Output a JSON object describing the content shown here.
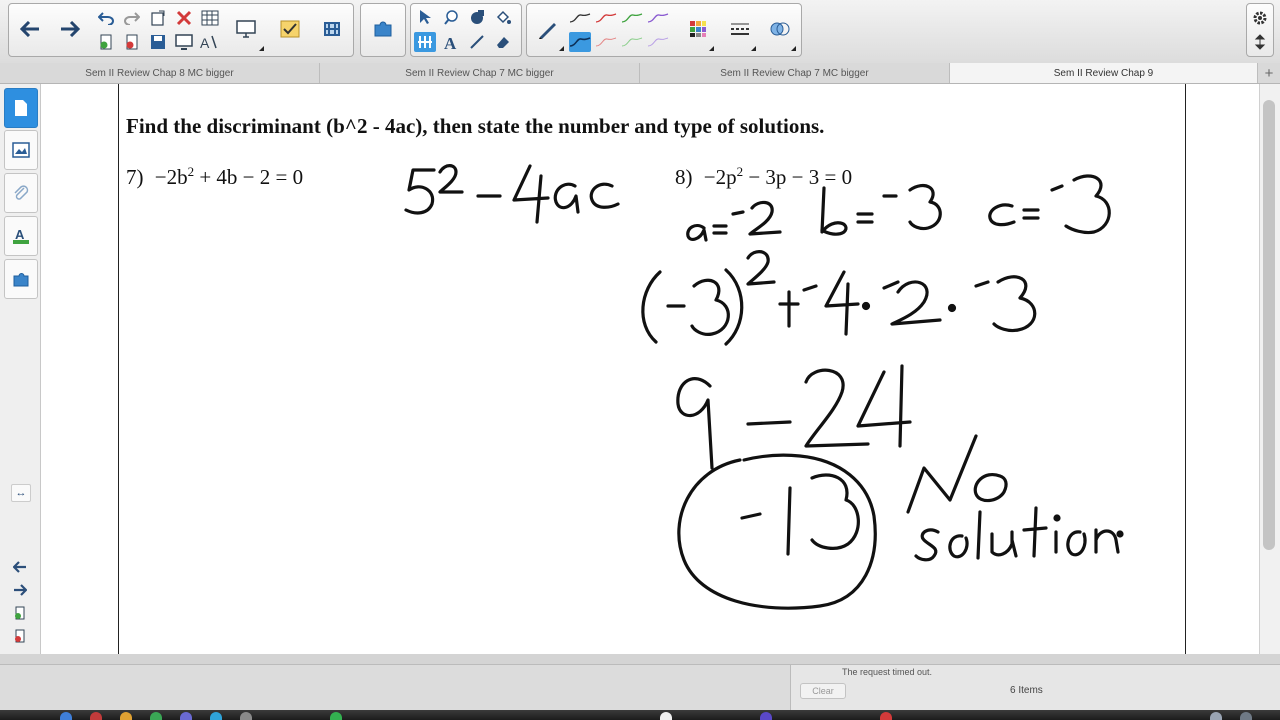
{
  "tabs": [
    {
      "label": "Sem II Review Chap 8 MC bigger",
      "active": false
    },
    {
      "label": "Sem II Review Chap 7 MC bigger",
      "active": false
    },
    {
      "label": "Sem II Review Chap 7 MC bigger",
      "active": false
    },
    {
      "label": "Sem II Review Chap 9",
      "active": true
    }
  ],
  "tab_add": "+",
  "page": {
    "heading": "Find the discriminant (b^2 - 4ac), then state the number and type of solutions.",
    "problem7": {
      "number": "7)",
      "equation_pre": "−2b",
      "exp": "2",
      "equation_post": " + 4b − 2 = 0"
    },
    "problem8": {
      "number": "8)",
      "equation_pre": "−2p",
      "exp": "2",
      "equation_post": " − 3p − 3 = 0"
    }
  },
  "downloads": {
    "status": "The request timed out.",
    "clear_label": "Clear",
    "count": "6 Items"
  },
  "colors": {
    "ink": "#111111",
    "accent": "#2e8fe0",
    "toolbar_red": "#d33a3a",
    "toolbar_green": "#3fa33f",
    "toolbar_purple": "#8a5ad1"
  },
  "icons": {
    "back": "arrow-left-icon",
    "forward": "arrow-right-icon",
    "undo": "undo-icon",
    "redo": "redo-icon",
    "delete": "red-x-icon",
    "settings": "gear-icon"
  }
}
